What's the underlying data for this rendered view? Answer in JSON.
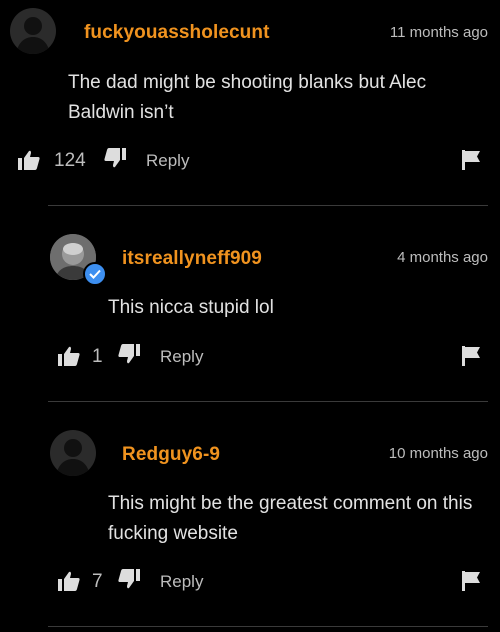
{
  "comments": [
    {
      "username": "fuckyouassholecunt",
      "time": "11 months ago",
      "text": "The dad might be shooting blanks but Alec Baldwin isn’t",
      "likes": "124",
      "reply_label": "Reply"
    },
    {
      "username": "itsreallyneff909",
      "time": "4 months ago",
      "text": "This nicca stupid lol",
      "likes": "1",
      "reply_label": "Reply"
    },
    {
      "username": "Redguy6-9",
      "time": "10 months ago",
      "text": "This might be the greatest comment on this fucking website",
      "likes": "7",
      "reply_label": "Reply"
    }
  ],
  "colors": {
    "background": "#000000",
    "username": "#f0931f",
    "text": "#e2e2e2",
    "meta": "#bdbdbd",
    "verified_badge": "#3d8ff0"
  },
  "icons": [
    "default-avatar-icon",
    "thumbs-up-icon",
    "thumbs-down-icon",
    "flag-icon",
    "verified-check-icon"
  ]
}
